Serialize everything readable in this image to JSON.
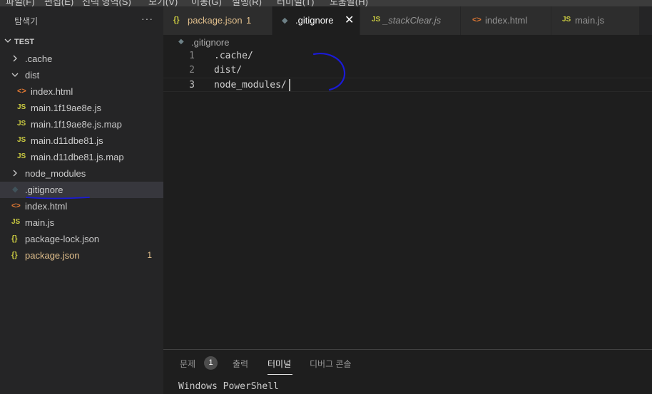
{
  "menubar": {
    "items": [
      "파일(F)",
      "편집(E)",
      "선택 영역(S)",
      "보기(V)",
      "이동(G)",
      "실행(R)",
      "터미널(T)",
      "도움말(H)"
    ]
  },
  "sidebar": {
    "title": "탐색기",
    "more": "···",
    "section": "TEST",
    "tree": [
      {
        "label": ".cache",
        "type": "folder",
        "icon": "chevron-right-icon"
      },
      {
        "label": "dist",
        "type": "folder-open",
        "icon": "chevron-down-icon"
      },
      {
        "label": "index.html",
        "type": "file",
        "icon": "html-file-icon",
        "glyph": "<>"
      },
      {
        "label": "main.1f19ae8e.js",
        "type": "file",
        "icon": "js-file-icon",
        "glyph": "JS"
      },
      {
        "label": "main.1f19ae8e.js.map",
        "type": "file",
        "icon": "js-file-icon",
        "glyph": "JS"
      },
      {
        "label": "main.d11dbe81.js",
        "type": "file",
        "icon": "js-file-icon",
        "glyph": "JS"
      },
      {
        "label": "main.d11dbe81.js.map",
        "type": "file",
        "icon": "js-file-icon",
        "glyph": "JS"
      },
      {
        "label": "node_modules",
        "type": "folder",
        "icon": "chevron-right-icon"
      },
      {
        "label": ".gitignore",
        "type": "file",
        "icon": "git-file-icon",
        "glyph": "◆"
      },
      {
        "label": "index.html",
        "type": "file",
        "icon": "html-file-icon",
        "glyph": "<>"
      },
      {
        "label": "main.js",
        "type": "file",
        "icon": "js-file-icon",
        "glyph": "JS"
      },
      {
        "label": "package-lock.json",
        "type": "file",
        "icon": "json-file-icon",
        "glyph": "{}"
      },
      {
        "label": "package.json",
        "type": "file",
        "icon": "json-file-icon",
        "glyph": "{}",
        "badge": "1"
      }
    ]
  },
  "tabs": [
    {
      "label": "package.json",
      "suffix": "1",
      "glyph": "{}"
    },
    {
      "label": ".gitignore",
      "glyph": "◆",
      "close": "✕"
    },
    {
      "label": "_stackClear.js",
      "glyph": "JS"
    },
    {
      "label": "index.html",
      "glyph": "<>"
    },
    {
      "label": "main.js",
      "glyph": "JS"
    }
  ],
  "breadcrumb": {
    "glyph": "◆",
    "label": ".gitignore"
  },
  "editor": {
    "lines": [
      {
        "number": "1",
        "text": ".cache/"
      },
      {
        "number": "2",
        "text": "dist/"
      },
      {
        "number": "3",
        "text": "node_modules/"
      }
    ]
  },
  "panel": {
    "tabs": [
      {
        "label": "문제",
        "count": "1"
      },
      {
        "label": "출력"
      },
      {
        "label": "터미널"
      },
      {
        "label": "디버그 콘솔"
      }
    ],
    "terminal_text": "Windows PowerShell"
  },
  "colors": {
    "accent_annotation": "#1a1ad6",
    "modified": "#e2c08d",
    "js_icon": "#cbcb41",
    "html_icon": "#e37933"
  }
}
